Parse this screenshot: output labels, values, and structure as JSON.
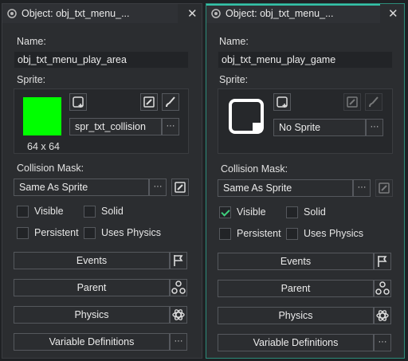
{
  "colors": {
    "accent_teal": "#35c2a8",
    "sprite_green": "#00ff00",
    "check_green": "#3fd17e"
  },
  "left": {
    "tab_title": "Object: obj_txt_menu_...",
    "name_label": "Name:",
    "name_value": "obj_txt_menu_play_area",
    "sprite_label": "Sprite:",
    "sprite_size": "64 x 64",
    "sprite_value": "spr_txt_collision",
    "collision_label": "Collision Mask:",
    "collision_value": "Same As Sprite",
    "visible": "Visible",
    "solid": "Solid",
    "persistent": "Persistent",
    "uses_physics": "Uses Physics",
    "events": "Events",
    "parent": "Parent",
    "physics": "Physics",
    "variables": "Variable Definitions",
    "dots": "···"
  },
  "right": {
    "tab_title": "Object: obj_txt_menu_...",
    "name_label": "Name:",
    "name_value": "obj_txt_menu_play_game",
    "sprite_label": "Sprite:",
    "sprite_value": "No Sprite",
    "collision_label": "Collision Mask:",
    "collision_value": "Same As Sprite",
    "visible": "Visible",
    "solid": "Solid",
    "persistent": "Persistent",
    "uses_physics": "Uses Physics",
    "events": "Events",
    "parent": "Parent",
    "physics": "Physics",
    "variables": "Variable Definitions",
    "dots": "···",
    "visible_checked": true
  }
}
